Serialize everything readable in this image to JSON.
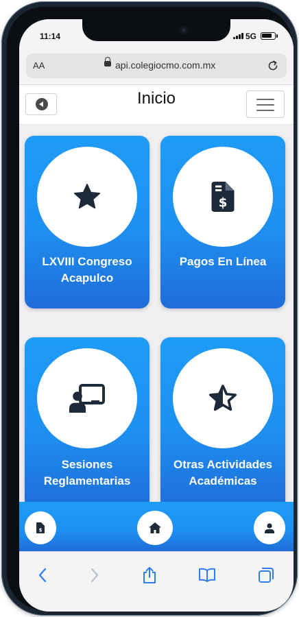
{
  "status_bar": {
    "time": "11:14",
    "network": "5G"
  },
  "browser": {
    "text_size_label": "AA",
    "url": "api.colegiocmo.com.mx"
  },
  "header": {
    "title": "Inicio"
  },
  "cards": [
    {
      "label_line1": "LXVIII Congreso",
      "label_line2": "Acapulco",
      "icon": "star-icon"
    },
    {
      "label_line1": "Pagos En Línea",
      "label_line2": "",
      "icon": "invoice-dollar-icon"
    },
    {
      "label_line1": "Sesiones",
      "label_line2": "Reglamentarias",
      "icon": "chalkboard-teacher-icon"
    },
    {
      "label_line1": "Otras Actividades",
      "label_line2": "Académicas",
      "icon": "half-star-icon"
    }
  ],
  "bottom_nav": {
    "left_icon": "document-icon",
    "center_icon": "home-icon",
    "right_icon": "user-icon"
  },
  "safari_toolbar": [
    "back-arrow-icon",
    "forward-arrow-icon",
    "share-icon",
    "bookmarks-icon",
    "tabs-icon"
  ],
  "colors": {
    "card_top": "#1e9cf6",
    "card_bottom": "#1f6cd8",
    "icon_dark": "#1c2a3a",
    "safari_blue": "#2f7cf6"
  }
}
